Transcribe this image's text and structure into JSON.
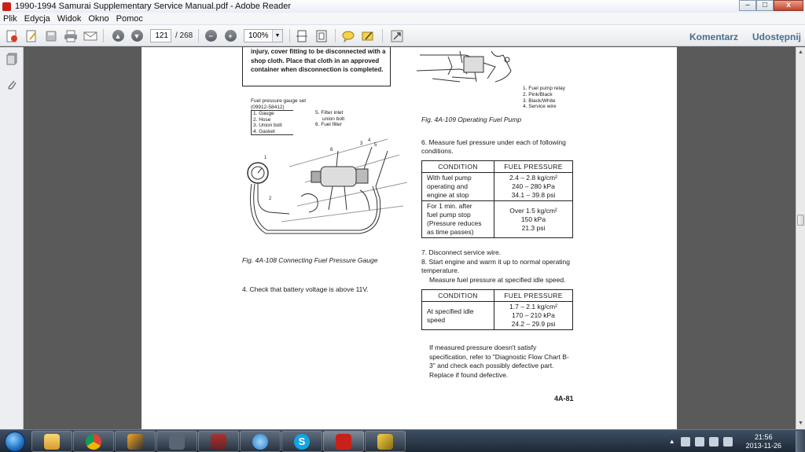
{
  "window": {
    "title": "1990-1994 Samurai Supplementary Service Manual.pdf - Adobe Reader",
    "controls": {
      "minimize": "–",
      "maximize": "□",
      "close": "x"
    }
  },
  "menu": [
    "Plik",
    "Edycja",
    "Widok",
    "Okno",
    "Pomoc"
  ],
  "toolbar": {
    "page_current": "121",
    "page_total": "/ 268",
    "zoom": "100%",
    "comment_label": "Komentarz",
    "share_label": "Udostępnij"
  },
  "document": {
    "warning_text": "injury, cover fitting to be disconnected with a shop cloth. Place that cloth in an approved container when disconnection is completed.",
    "gauge_set_title": "Fuel pressure gauge set",
    "gauge_set_part": "(09912-58412)",
    "gauge_parts_left": [
      "1. Gauge",
      "2. Hose",
      "3. Union bolt",
      "4. Gasket"
    ],
    "gauge_parts_right": [
      "5. Filter inlet",
      "union bolt",
      "6. Fuel filter"
    ],
    "fig108_caption": "Fig. 4A-108  Connecting Fuel Pressure Gauge",
    "step4": "4. Check that battery voltage is above 11V.",
    "relay_legend": [
      "1. Fuel pump relay",
      "2. Pink/Black",
      "3. Black/White",
      "4. Service wire"
    ],
    "fig109_caption": "Fig. 4A-109  Operating Fuel Pump",
    "step6": "6. Measure fuel pressure under each of following conditions.",
    "table1": {
      "headers": [
        "CONDITION",
        "FUEL PRESSURE"
      ],
      "rows": [
        {
          "condition": [
            "With fuel pump",
            "operating and",
            "engine at stop"
          ],
          "pressure": [
            "2.4 – 2.8 kg/cm²",
            "240 – 280 kPa",
            "34.1 – 39.8 psi"
          ]
        },
        {
          "condition": [
            "For 1 min. after",
            "fuel pump stop",
            "(Pressure reduces",
            "as time passes)"
          ],
          "pressure": [
            "Over 1.5 kg/cm²",
            "150 kPa",
            "21.3 psi"
          ]
        }
      ]
    },
    "step7": "7. Disconnect service wire.",
    "step8": "8. Start engine and warm it up to normal operating temperature.",
    "step8_sub": "Measure fuel pressure at specified idle speed.",
    "table2": {
      "headers": [
        "CONDITION",
        "FUEL PRESSURE"
      ],
      "rows": [
        {
          "condition": [
            "At specified idle",
            "speed"
          ],
          "pressure": [
            "1.7 – 2.1 kg/cm²",
            "170 – 210 kPa",
            "24.2 – 29.9 psi"
          ]
        }
      ]
    },
    "note": "If measured pressure doesn't satisfy specification, refer to \"Diagnostic Flow Chart B-3\" and check each possibly defective part. Replace if found defective.",
    "page_number": "4A-81"
  },
  "taskbar": {
    "apps": [
      "explorer",
      "chrome",
      "winamp",
      "media",
      "game",
      "itunes",
      "skype",
      "acrobat",
      "tool"
    ],
    "clock_time": "21:56",
    "clock_date": "2013-11-26"
  },
  "colors": {
    "accent": "#47708f",
    "taskbar": "#1d2836"
  }
}
